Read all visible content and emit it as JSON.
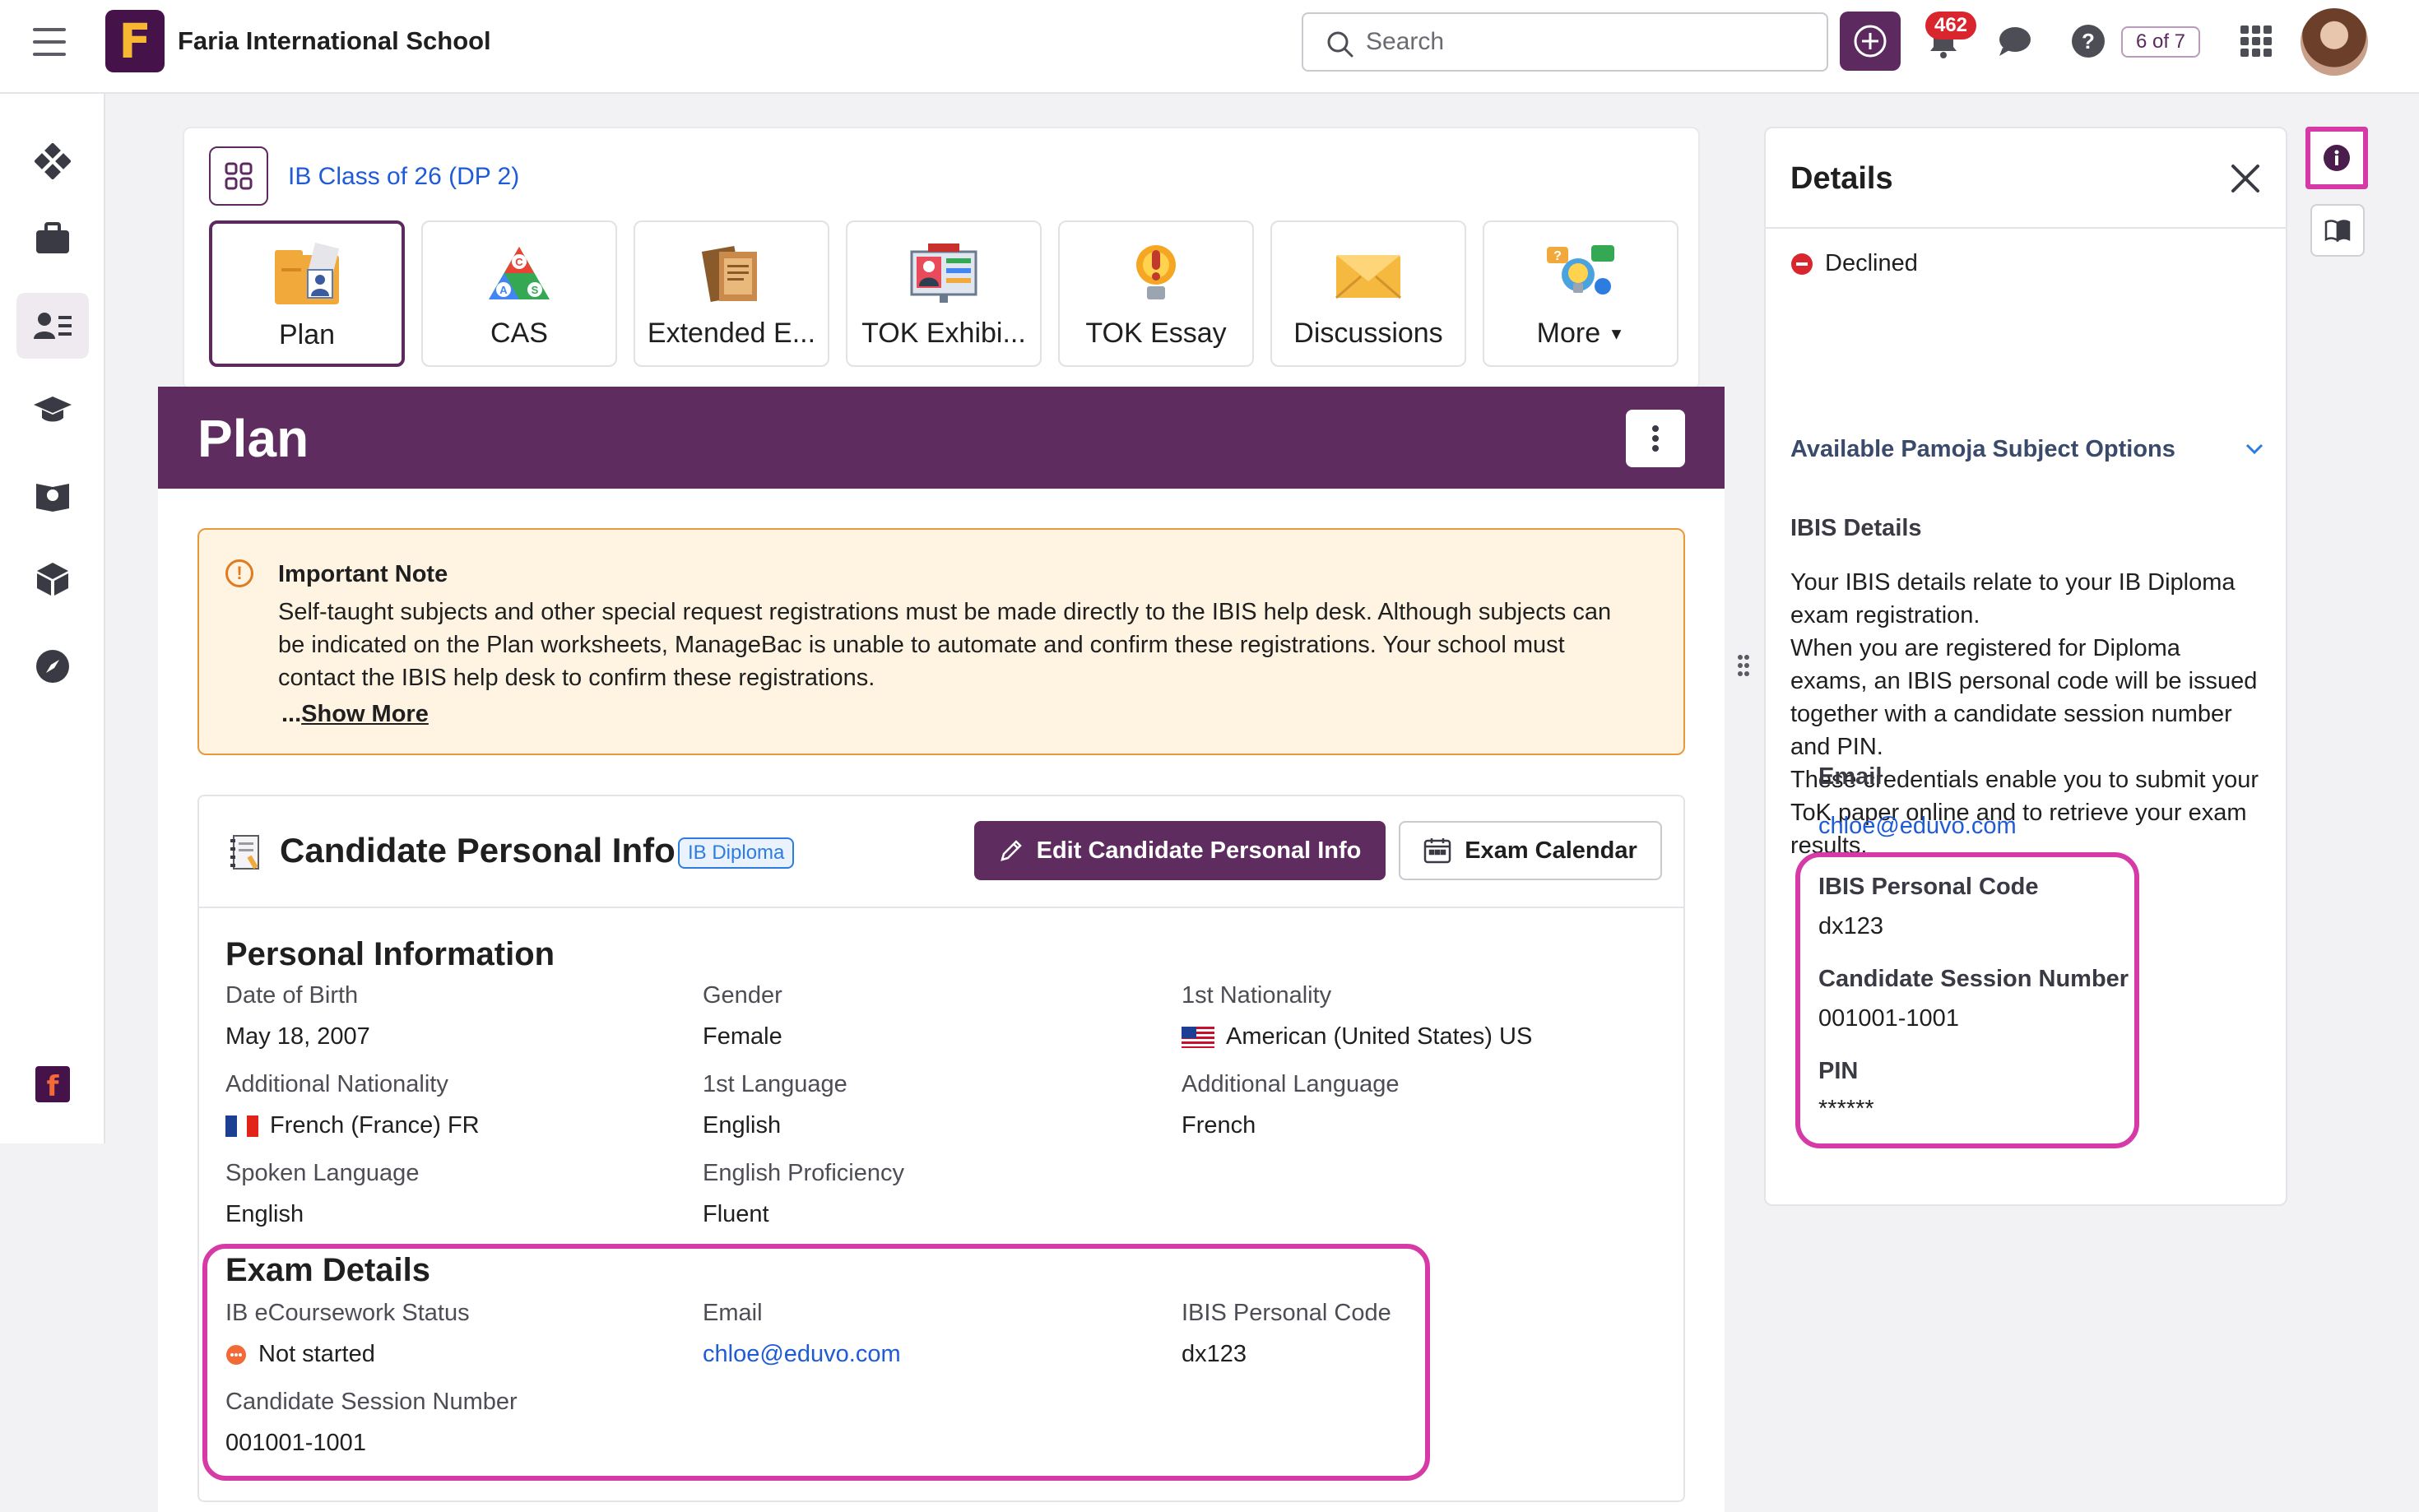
{
  "app": {
    "school_name": "Faria International School",
    "logo_letter": "F",
    "brand_color": "#5e2c5f"
  },
  "topbar": {
    "search_placeholder": "Search",
    "notification_count": "462",
    "pager": "6 of 7",
    "icons": [
      "menu-icon",
      "search-icon",
      "add-icon",
      "bell-icon",
      "chat-icon",
      "help-icon",
      "apps-grid-icon"
    ]
  },
  "leftnav": {
    "icons": [
      "dashboard-icon",
      "briefcase-icon",
      "student-card-icon",
      "graduation-cap-icon",
      "map-book-icon",
      "cube-icon",
      "compass-icon"
    ],
    "active_index": 2
  },
  "course": {
    "class_name": "IB Class of 26 (DP 2)",
    "tabs": [
      {
        "label": "Plan",
        "icon": "plan-icon",
        "active": true
      },
      {
        "label": "CAS",
        "icon": "cas-icon"
      },
      {
        "label": "Extended E...",
        "icon": "extended-essay-icon"
      },
      {
        "label": "TOK Exhibi...",
        "icon": "tok-exhibition-icon"
      },
      {
        "label": "TOK Essay",
        "icon": "tok-essay-icon"
      },
      {
        "label": "Discussions",
        "icon": "discussions-icon"
      },
      {
        "label": "More",
        "icon": "more-icon"
      }
    ]
  },
  "plan": {
    "title": "Plan"
  },
  "note": {
    "title": "Important Note",
    "body": "Self-taught subjects and other special request registrations must be made directly to the IBIS help desk. Although subjects can be indicated on the Plan worksheets, ManageBac is unable to automate and confirm these registrations. Your school must contact the IBIS help desk to confirm these registrations.",
    "ellipsis": "...",
    "show_more": "Show More"
  },
  "candidate": {
    "title": "Candidate Personal Info",
    "badge": "IB Diploma",
    "edit_label": "Edit Candidate Personal Info",
    "calendar_label": "Exam Calendar",
    "personal_title": "Personal Information",
    "fields": {
      "dob_label": "Date of Birth",
      "dob_value": "May 18, 2007",
      "gender_label": "Gender",
      "gender_value": "Female",
      "nat1_label": "1st Nationality",
      "nat1_value": "American (United States) US",
      "addnat_label": "Additional Nationality",
      "addnat_value": "French (France) FR",
      "lang1_label": "1st Language",
      "lang1_value": "English",
      "addlang_label": "Additional Language",
      "addlang_value": "French",
      "spoken_label": "Spoken Language",
      "spoken_value": "English",
      "prof_label": "English Proficiency",
      "prof_value": "Fluent"
    },
    "exam_title": "Exam Details",
    "exam": {
      "status_label": "IB eCoursework Status",
      "status_value": "Not started",
      "email_label": "Email",
      "email_value": "chloe@eduvo.com",
      "code_label": "IBIS Personal Code",
      "code_value": "dx123",
      "session_label": "Candidate Session Number",
      "session_value": "001001-1001"
    }
  },
  "details": {
    "title": "Details",
    "declined": "Declined",
    "accordion": "Available Pamoja Subject Options",
    "ibis_heading": "IBIS Details",
    "ibis_para": "Your IBIS details relate to your IB Diploma exam registration.\nWhen you are registered for Diploma exams, an IBIS personal code will be issued together with a candidate session number and PIN.\nThese credentials enable you to submit your ToK paper online and to retrieve your exam results.",
    "email_label": "Email",
    "email_value": "chloe@eduvo.com",
    "code_label": "IBIS Personal Code",
    "code_value": "dx123",
    "session_label": "Candidate Session Number",
    "session_value": "001001-1001",
    "pin_label": "PIN",
    "pin_value": "******"
  },
  "colors": {
    "highlight": "#d63aa6",
    "link": "#1f5bd6",
    "note_bg": "#fff3e2",
    "note_border": "#e69a3b",
    "declined": "#d9262e"
  }
}
